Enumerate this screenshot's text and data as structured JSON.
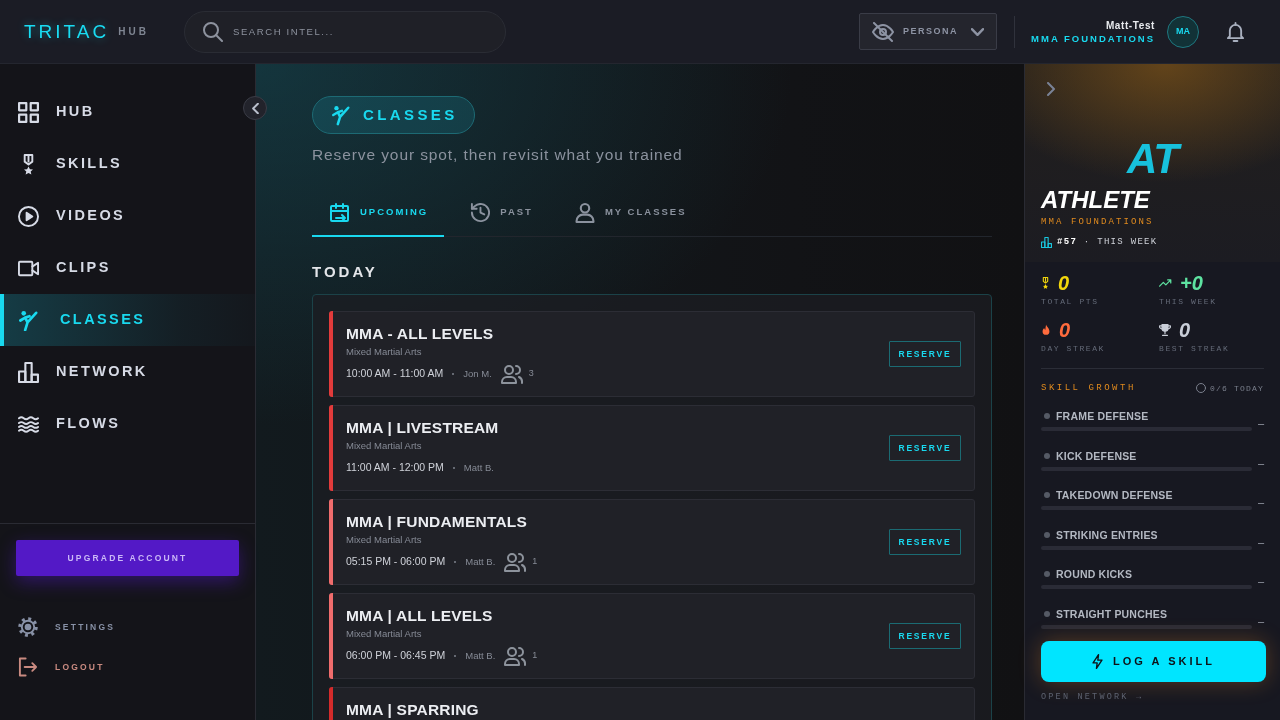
{
  "top_bar": {
    "logo": {
      "brand": "TRITAC",
      "suffix": "HUB"
    },
    "search": {
      "placeholder": "SEARCH INTEL..."
    },
    "persona": {
      "label": "PERSONA"
    },
    "user": {
      "name": "Matt-Test",
      "program": "MMA FOUNDATIONS",
      "initials": "MA"
    }
  },
  "sidebar": {
    "items": [
      {
        "label": "HUB",
        "selected": false
      },
      {
        "label": "SKILLS",
        "selected": false
      },
      {
        "label": "VIDEOS",
        "selected": false
      },
      {
        "label": "CLIPS",
        "selected": false
      },
      {
        "label": "CLASSES",
        "selected": true
      },
      {
        "label": "NETWORK",
        "selected": false
      },
      {
        "label": "FLOWS",
        "selected": false
      }
    ],
    "upgrade_button": "UPGRADE ACCOUNT",
    "footer_links": [
      {
        "label": "SETTINGS",
        "kind": "settings"
      },
      {
        "label": "LOGOUT",
        "kind": "logout"
      }
    ]
  },
  "main": {
    "heading": "CLASSES",
    "subtitle": "Reserve your spot, then revisit what you trained",
    "tabs": [
      {
        "label": "UPCOMING",
        "selected": true
      },
      {
        "label": "PAST",
        "selected": false
      },
      {
        "label": "MY CLASSES",
        "selected": false
      }
    ],
    "section_title": "TODAY",
    "classes": [
      {
        "title": "MMA - ALL LEVELS",
        "category": "Mixed Martial Arts",
        "time": "10:00 AM - 11:00 AM",
        "instructor": "Jon M.",
        "attendees": "3",
        "action": "RESERVE",
        "color": "#e23b3b"
      },
      {
        "title": "MMA | LIVESTREAM",
        "category": "Mixed Martial Arts",
        "time": "11:00 AM - 12:00 PM",
        "instructor": "Matt B.",
        "action": "RESERVE",
        "color": "#e23b3b"
      },
      {
        "title": "MMA | FUNDAMENTALS",
        "category": "Mixed Martial Arts",
        "time": "05:15 PM - 06:00 PM",
        "instructor": "Matt B.",
        "attendees": "1",
        "action": "RESERVE",
        "color": "#f06c6c"
      },
      {
        "title": "MMA | ALL LEVELS",
        "category": "Mixed Martial Arts",
        "time": "06:00 PM - 06:45 PM",
        "instructor": "Matt B.",
        "attendees": "1",
        "action": "RESERVE",
        "color": "#f06c6c"
      },
      {
        "title": "MMA | SPARRING",
        "color": "#d42b2b"
      }
    ]
  },
  "athlete_panel": {
    "initials": "AT",
    "name": "ATHLETE",
    "program": "MMA FOUNDATIONS",
    "rank": "**#57** · THIS WEEK",
    "stats": [
      {
        "value": "0",
        "label": "TOTAL PTS",
        "color": "#f2d60c"
      },
      {
        "value": "+0",
        "label": "THIS WEEK",
        "color": "#5ee3a1"
      },
      {
        "value": "0",
        "label": "DAY STREAK",
        "color": "#ff6b3d"
      },
      {
        "value": "0",
        "label": "BEST STREAK",
        "color": "#c9ced8"
      }
    ],
    "skill_growth": {
      "title": "SKILL GROWTH",
      "today_count": "0/6 TODAY",
      "skills": [
        {
          "name": "FRAME DEFENSE",
          "level": 0,
          "reading": "–"
        },
        {
          "name": "KICK DEFENSE",
          "level": 0,
          "reading": "–"
        },
        {
          "name": "TAKEDOWN DEFENSE",
          "level": 0,
          "reading": "–"
        },
        {
          "name": "STRIKING ENTRIES",
          "level": 0,
          "reading": "–"
        },
        {
          "name": "ROUND KICKS",
          "level": 0,
          "reading": "–"
        },
        {
          "name": "STRAIGHT PUNCHES",
          "level": 0,
          "reading": "–"
        }
      ]
    },
    "log_button": "LOG A SKILL",
    "footer_link": "OPEN NETWORK →"
  }
}
